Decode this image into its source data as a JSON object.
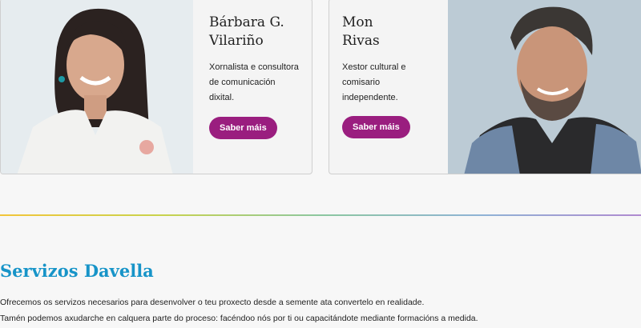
{
  "people": [
    {
      "name_line1": "Bárbara G.",
      "name_line2": "Vilariño",
      "bio_line1": "Xornalista e consultora",
      "bio_line2": "de comunicación",
      "bio_line3": "dixital.",
      "button": "Saber máis"
    },
    {
      "name_line1": "Mon",
      "name_line2": "Rivas",
      "bio_line1": "Xestor cultural e",
      "bio_line2": "comisario",
      "bio_line3": "independente.",
      "button": "Saber máis"
    }
  ],
  "services": {
    "title": "Servizos Davella",
    "line1": "Ofrecemos os servizos necesarios para desenvolver o teu proxecto desde a semente ata convertelo en realidade.",
    "line2": "Tamén podemos axudarche en calquera parte do proceso: facéndoo nós por ti ou capacitándote mediante formacións a medida."
  },
  "colors": {
    "accent_button": "#9a1e7f",
    "section_title": "#1794c8"
  }
}
